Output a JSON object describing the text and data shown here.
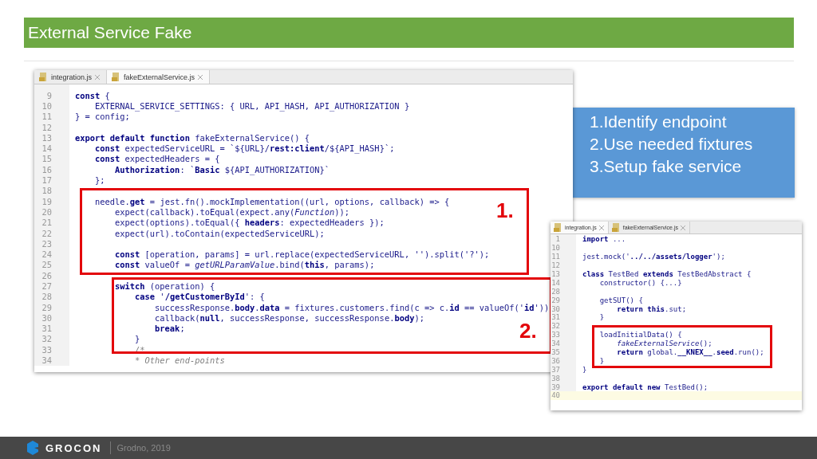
{
  "title": "External Service Fake",
  "editors": [
    {
      "tabs": [
        {
          "label": "integration.js",
          "selected": false
        },
        {
          "label": "fakeExternalService.js",
          "selected": true
        }
      ],
      "lines": [
        {
          "no": "9",
          "kind": "code",
          "code": "**const** {"
        },
        {
          "no": "10",
          "kind": "code",
          "code": "    EXTERNAL_SERVICE_SETTINGS: { URL, API_HASH, API_AUTHORIZATION }"
        },
        {
          "no": "11",
          "kind": "code",
          "code": "} = config;"
        },
        {
          "no": "12"
        },
        {
          "no": "13",
          "kind": "code",
          "code": "**export default function** fakeExternalService() {"
        },
        {
          "no": "14",
          "kind": "code",
          "code": "    **const** expectedServiceURL = `${URL}/**rest:client**/${API_HASH}`;"
        },
        {
          "no": "15",
          "kind": "code",
          "code": "    **const** expectedHeaders = {"
        },
        {
          "no": "16",
          "kind": "code",
          "code": "        **Authorization**: `**Basic** ${API_AUTHORIZATION}`"
        },
        {
          "no": "17",
          "kind": "code",
          "code": "    };"
        },
        {
          "no": "18"
        },
        {
          "no": "19",
          "kind": "code",
          "code": "    needle.**get** = jest.fn().mockImplementation((url, options, callback) => {"
        },
        {
          "no": "20",
          "kind": "code",
          "code": "        expect(callback).toEqual(expect.any(*Function*));"
        },
        {
          "no": "21",
          "kind": "code",
          "code": "        expect(options).toEqual({ **headers**: expectedHeaders });"
        },
        {
          "no": "22",
          "kind": "code",
          "code": "        expect(url).toContain(expectedServiceURL);"
        },
        {
          "no": "23"
        },
        {
          "no": "24",
          "kind": "code",
          "code": "        **const** [operation, params] = url.replace(expectedServiceURL, '').split('?');"
        },
        {
          "no": "25",
          "kind": "code",
          "code": "        **const** valueOf = *getURLParamValue*.bind(**this**, params);"
        },
        {
          "no": "26"
        },
        {
          "no": "27",
          "kind": "code",
          "code": "        **switch** (operation) {"
        },
        {
          "no": "28",
          "kind": "code",
          "code": "            **case** '**/getCustomerById**': {"
        },
        {
          "no": "29",
          "kind": "code",
          "code": "                successResponse.**body**.**data** = fixtures.customers.find(c => c.**id** == valueOf('**id**'))"
        },
        {
          "no": "30",
          "kind": "code",
          "code": "                callback(**null**, successResponse, successResponse.**body**);"
        },
        {
          "no": "31",
          "kind": "code",
          "code": "                **break**;"
        },
        {
          "no": "32",
          "kind": "code",
          "code": "            }"
        },
        {
          "no": "33",
          "kind": "comment",
          "code": "            /*"
        },
        {
          "no": "34",
          "kind": "comment",
          "code": "            * Other end-points"
        }
      ]
    },
    {
      "tabs": [
        {
          "label": "integration.js",
          "selected": true
        },
        {
          "label": "fakeExternalService.js",
          "selected": false
        }
      ],
      "lines": [
        {
          "no": "1",
          "kind": "code",
          "code": "**import** ...",
          "current": false
        },
        {
          "no": "10",
          "current": false
        },
        {
          "no": "11",
          "kind": "code",
          "code": "jest.mock('**../../assets/logger**');",
          "current": false
        },
        {
          "no": "12",
          "current": false
        },
        {
          "no": "13",
          "kind": "code",
          "code": "**class** TestBed **extends** TestBedAbstract {",
          "current": false
        },
        {
          "no": "14",
          "kind": "code",
          "code": "    constructor() {...}",
          "current": false
        },
        {
          "no": "28",
          "current": false
        },
        {
          "no": "29",
          "kind": "code",
          "code": "    getSUT() {",
          "current": false
        },
        {
          "no": "30",
          "kind": "code",
          "code": "        **return this**.sut;",
          "current": false
        },
        {
          "no": "31",
          "kind": "code",
          "code": "    }",
          "current": false
        },
        {
          "no": "32",
          "current": false
        },
        {
          "no": "33",
          "kind": "code",
          "code": "    loadInitialData() {",
          "current": false
        },
        {
          "no": "34",
          "kind": "code",
          "code": "        *fakeExternalService*();",
          "current": false
        },
        {
          "no": "35",
          "kind": "code",
          "code": "        **return** global.**__KNEX__**.**seed**.run();",
          "current": false
        },
        {
          "no": "36",
          "kind": "code",
          "code": "    }",
          "current": false
        },
        {
          "no": "37",
          "kind": "code",
          "code": "}",
          "current": false
        },
        {
          "no": "38",
          "current": false
        },
        {
          "no": "39",
          "kind": "code",
          "code": "**export default new** TestBed();",
          "current": false
        },
        {
          "no": "40",
          "current": true
        }
      ]
    }
  ],
  "markers": [
    {
      "label": "1."
    },
    {
      "label": "2."
    }
  ],
  "steps": [
    "1.Identify endpoint",
    "2.Use needed fixtures",
    "3.Setup fake service"
  ],
  "footer": {
    "brand": "GROCON",
    "place": "Grodno, 2019"
  }
}
